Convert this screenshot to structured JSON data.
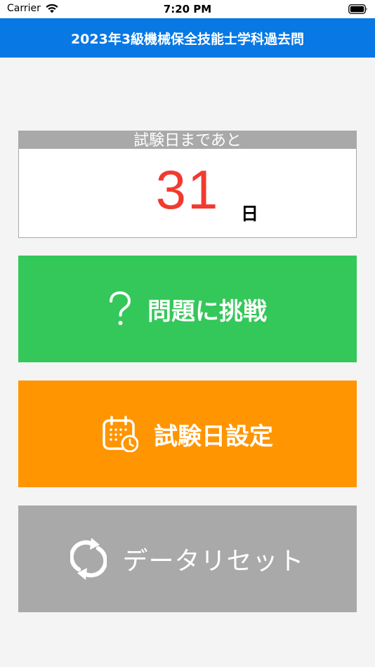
{
  "status_bar": {
    "carrier": "Carrier",
    "time": "7:20 PM"
  },
  "nav": {
    "title": "2023年3級機械保全技能士学科過去問"
  },
  "countdown": {
    "label": "試験日まであと",
    "days": "31",
    "unit": "日"
  },
  "buttons": {
    "challenge": {
      "label": "問題に挑戦",
      "icon": "question-mark-icon",
      "color": "#34c759"
    },
    "exam_date": {
      "label": "試験日設定",
      "icon": "calendar-clock-icon",
      "color": "#ff9500"
    },
    "reset": {
      "label": "データリセット",
      "icon": "refresh-icon",
      "color": "#a9a9a9"
    }
  },
  "colors": {
    "nav": "#0878e4",
    "countdown_number": "#f23a2f",
    "background": "#f4f4f4"
  }
}
